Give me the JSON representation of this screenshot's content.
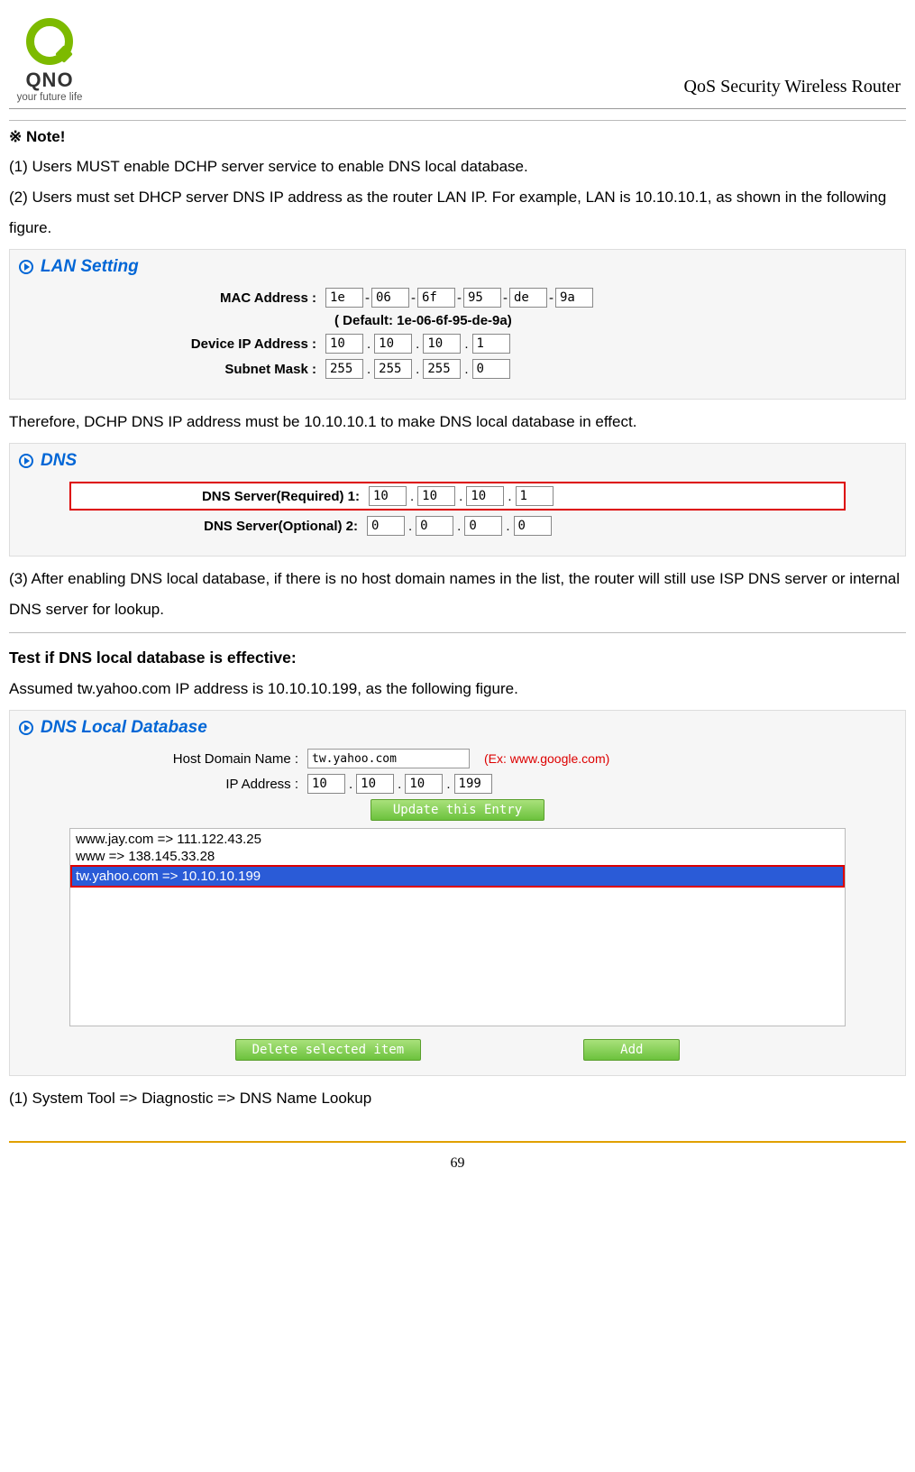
{
  "header": {
    "brand": "QNO",
    "tagline": "your future life",
    "right": "QoS Security Wireless Router"
  },
  "note_title": "※ Note!",
  "p1": "(1) Users MUST enable DCHP server service to enable DNS local database.",
  "p2": "(2) Users must set DHCP server DNS IP address as the router LAN IP.   For example, LAN is 10.10.10.1, as shown in the following figure.",
  "lan": {
    "title": "LAN Setting",
    "mac_label": "MAC Address :",
    "mac": [
      "1e",
      "06",
      "6f",
      "95",
      "de",
      "9a"
    ],
    "mac_default": "( Default: 1e-06-6f-95-de-9a)",
    "ip_label": "Device IP Address :",
    "ip": [
      "10",
      "10",
      "10",
      "1"
    ],
    "mask_label": "Subnet Mask :",
    "mask": [
      "255",
      "255",
      "255",
      "0"
    ]
  },
  "p3": "Therefore, DCHP DNS IP address must be 10.10.10.1 to make DNS local database in effect.",
  "dns": {
    "title": "DNS",
    "req_label": "DNS Server(Required) 1:",
    "req": [
      "10",
      "10",
      "10",
      "1"
    ],
    "opt_label": "DNS Server(Optional) 2:",
    "opt": [
      "0",
      "0",
      "0",
      "0"
    ]
  },
  "p4": "(3) After enabling DNS local database, if there is no host domain names in the list, the router will still use ISP DNS server or internal DNS server for lookup.",
  "test_title": "Test if DNS local database is effective:",
  "p5": "Assumed tw.yahoo.com IP address is 10.10.10.199, as the following figure.",
  "db": {
    "title": "DNS Local Database",
    "host_label": "Host Domain Name :",
    "host_value": "tw.yahoo.com",
    "host_example": "(Ex: www.google.com)",
    "ip_label": "IP Address :",
    "ip": [
      "10",
      "10",
      "10",
      "199"
    ],
    "update_btn": "Update this Entry",
    "items": [
      "www.jay.com => 111.122.43.25",
      "www => 138.145.33.28",
      "tw.yahoo.com => 10.10.10.199"
    ],
    "delete_btn": "Delete selected item",
    "add_btn": "Add"
  },
  "p6": "(1) System Tool => Diagnostic => DNS Name Lookup",
  "page_num": "69"
}
